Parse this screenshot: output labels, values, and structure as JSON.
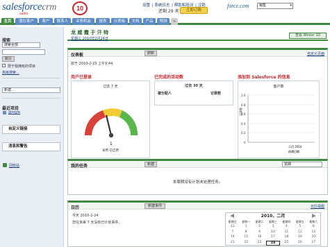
{
  "header": {
    "logo_main": "salesforce",
    "logo_crm": "crm",
    "logo_badge": "10",
    "logo_sub": "sales",
    "links": [
      "设置",
      "系统日志",
      "帮助和培训",
      "注销"
    ],
    "trial": "还剩 29 天",
    "upgrade": "立即订购",
    "force": "force.com",
    "app_select": "销售"
  },
  "tabs": [
    {
      "label": "主页",
      "active": true
    },
    {
      "label": "潜在客户"
    },
    {
      "label": "客户"
    },
    {
      "label": "联系人"
    },
    {
      "label": "业务机会"
    },
    {
      "label": "报表"
    },
    {
      "label": "仪表板"
    },
    {
      "label": "文档"
    },
    {
      "label": "产品"
    },
    {
      "label": "预测"
    },
    {
      "label": "+"
    }
  ],
  "sidebar": {
    "search_title": "搜索",
    "search_scope": "搜索全部",
    "search_button": "执行",
    "limit_label": "限于我拥有的项目",
    "advanced_link": "高级搜索...",
    "create_select": "新建...",
    "recent_title": "最近项目",
    "recent_item": "google",
    "custom_link": "自定义链接",
    "messages": "消息和警告",
    "recycle": "回收站"
  },
  "page": {
    "title": "龙 威 霞 于 汗 特",
    "date": "星期三 2010年2月24日",
    "help_button": "查看 Winter 10"
  },
  "dashboard": {
    "title": "仪表板",
    "refresh": "刷新",
    "customize": "自定义页面",
    "as_of": "如于 2010-2-23 上午9:44",
    "components": [
      {
        "title": "用户已登录",
        "subtitle": "过去 7 天",
        "footer": "采用 已启用",
        "gauge_value": 1
      },
      {
        "title": "已完成的活动数",
        "subtitle": "过去 30 天",
        "col1": "被分配人",
        "col2": "记录数"
      },
      {
        "title": "添加到 Salesforce 的信息",
        "subtitle": "客户数",
        "y_axis": "记录数",
        "x_label": "二月 2010",
        "x_sub": "创建日期",
        "y_ticks": [
          "1.0",
          "0.8",
          "0.6",
          "0.4",
          "0.2",
          "0"
        ]
      }
    ]
  },
  "tasks": {
    "title": "我的任务",
    "new_button": "新建",
    "filter": "逾期",
    "empty": "本周期没有计划未处理任务。"
  },
  "calendar": {
    "title": "日历",
    "new_event": "新建事件",
    "view_link": "日历视图",
    "today": "今天 2010-2-24",
    "empty": "您在未来 7 天没有已计划事件。",
    "month": "2010，二月",
    "weekdays": [
      "星期日",
      "星期一",
      "星期二",
      "星期三",
      "星期四",
      "星期五",
      "星期六"
    ],
    "weeks": [
      [
        "31",
        "1",
        "2",
        "3",
        "4",
        "5",
        "6"
      ],
      [
        "7",
        "8",
        "9",
        "10",
        "11",
        "12",
        "13"
      ],
      [
        "14",
        "15",
        "16",
        "17",
        "18",
        "19",
        "20"
      ],
      [
        "21",
        "22",
        "23",
        "24",
        "25",
        "26",
        "27"
      ]
    ],
    "today_day": "24"
  }
}
